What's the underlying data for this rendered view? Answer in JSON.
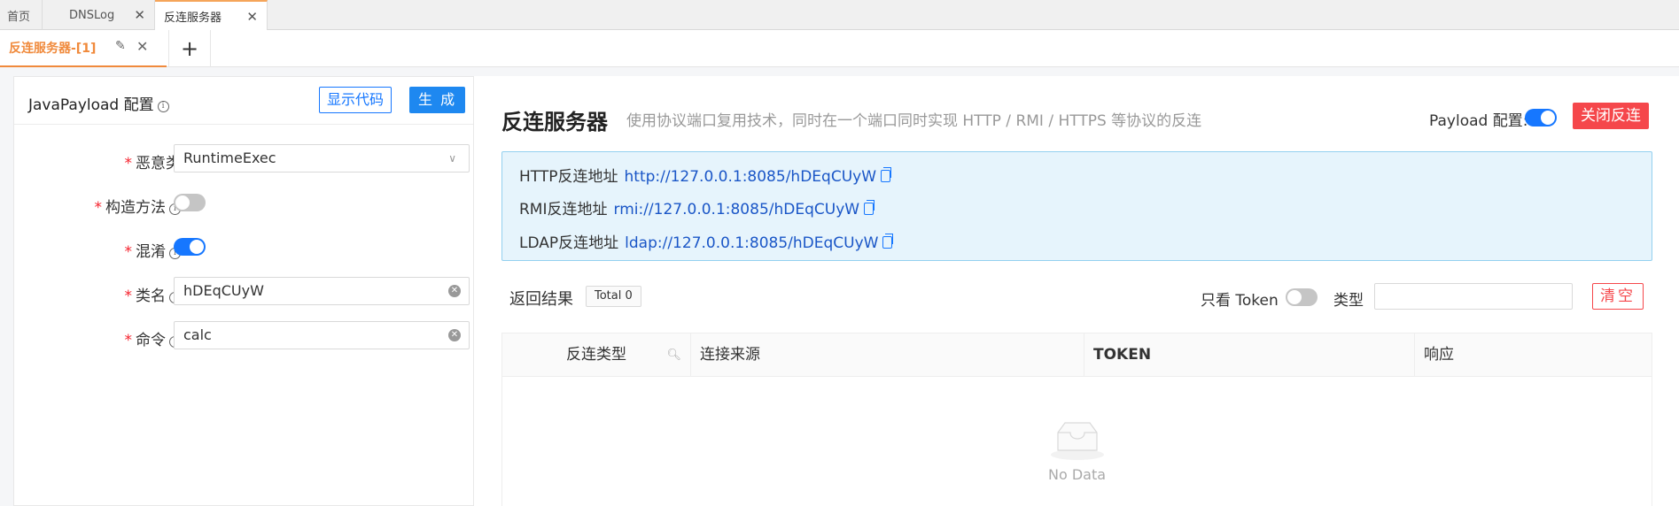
{
  "top_tabs": [
    {
      "label": "首页"
    },
    {
      "label": "DNSLog"
    },
    {
      "label": "反连服务器"
    }
  ],
  "sub_tab": {
    "label": "反连服务器-[1]",
    "add_label": "+"
  },
  "left_panel": {
    "title": "JavaPayload 配置",
    "show_code_label": "显示代码",
    "generate_label": "生 成",
    "fields": [
      {
        "label": "恶意类",
        "value": "RuntimeExec",
        "type": "select"
      },
      {
        "label": "构造方法",
        "type": "toggle",
        "on": false
      },
      {
        "label": "混淆",
        "type": "toggle",
        "on": true
      },
      {
        "label": "类名",
        "value": "hDEqCUyW",
        "type": "input"
      },
      {
        "label": "命令",
        "value": "calc",
        "type": "input"
      }
    ]
  },
  "right_panel": {
    "title": "反连服务器",
    "subtitle": "使用协议端口复用技术，同时在一个端口同时实现 HTTP / RMI / HTTPS 等协议的反连",
    "payload_config_label": "Payload 配置:",
    "payload_config_on": true,
    "close_button_label": "关闭反连",
    "addresses": [
      {
        "label": "HTTP反连地址",
        "url": "http://127.0.0.1:8085/hDEqCUyW"
      },
      {
        "label": "RMI反连地址",
        "url": "rmi://127.0.0.1:8085/hDEqCUyW"
      },
      {
        "label": "LDAP反连地址",
        "url": "ldap://127.0.0.1:8085/hDEqCUyW"
      }
    ],
    "results_label": "返回结果",
    "total_badge": "Total 0",
    "token_only_label": "只看 Token",
    "token_only_on": false,
    "type_label": "类型",
    "type_value": "",
    "clear_label": "清空",
    "table": {
      "columns": [
        "反连类型",
        "连接来源",
        "TOKEN",
        "响应"
      ],
      "empty_text": "No Data"
    }
  },
  "colors": {
    "accent": "#1677ff",
    "tab_active": "#f08a3c",
    "danger": "#f5474b"
  }
}
